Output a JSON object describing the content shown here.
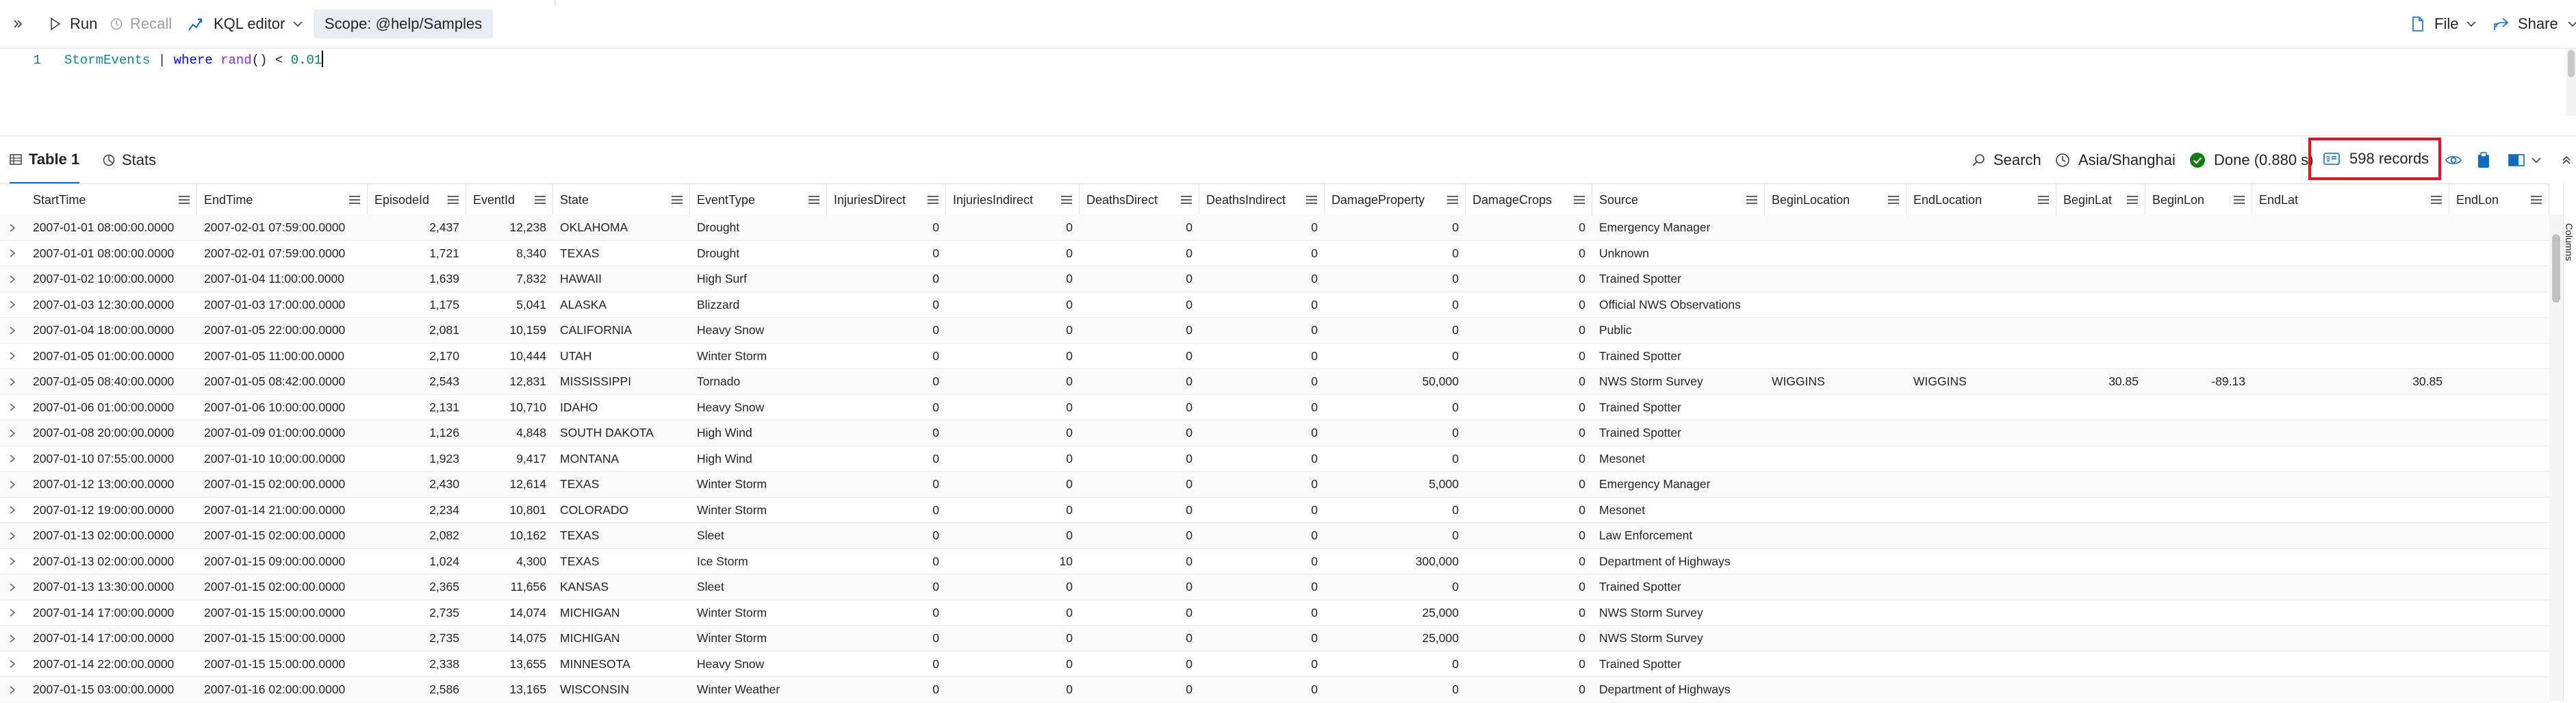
{
  "toolbar": {
    "run_label": "Run",
    "recall_label": "Recall",
    "kql_editor_label": "KQL editor",
    "scope_label": "Scope: @help/Samples",
    "file_label": "File",
    "share_label": "Share"
  },
  "editor": {
    "line_number": "1",
    "tokens": {
      "table": "StormEvents",
      "pipe": " | ",
      "keyword": "where",
      "space": " ",
      "function": "rand",
      "rest": "() < ",
      "number": "0.01"
    }
  },
  "results": {
    "tab_table": "Table 1",
    "tab_stats": "Stats",
    "search_label": "Search",
    "timezone": "Asia/Shanghai",
    "status": "Done (0.880 s)",
    "records": "598 records",
    "columns_panel": "Columns"
  },
  "columns": [
    "StartTime",
    "EndTime",
    "EpisodeId",
    "EventId",
    "State",
    "EventType",
    "InjuriesDirect",
    "InjuriesIndirect",
    "DeathsDirect",
    "DeathsIndirect",
    "DamageProperty",
    "DamageCrops",
    "Source",
    "BeginLocation",
    "EndLocation",
    "BeginLat",
    "BeginLon",
    "EndLat",
    "EndLon"
  ],
  "rows": [
    [
      "2007-01-01 08:00:00.0000",
      "2007-02-01 07:59:00.0000",
      "2,437",
      "12,238",
      "OKLAHOMA",
      "Drought",
      "0",
      "0",
      "0",
      "0",
      "0",
      "0",
      "Emergency Manager",
      "",
      "",
      "",
      "",
      "",
      ""
    ],
    [
      "2007-01-01 08:00:00.0000",
      "2007-02-01 07:59:00.0000",
      "1,721",
      "8,340",
      "TEXAS",
      "Drought",
      "0",
      "0",
      "0",
      "0",
      "0",
      "0",
      "Unknown",
      "",
      "",
      "",
      "",
      "",
      ""
    ],
    [
      "2007-01-02 10:00:00.0000",
      "2007-01-04 11:00:00.0000",
      "1,639",
      "7,832",
      "HAWAII",
      "High Surf",
      "0",
      "0",
      "0",
      "0",
      "0",
      "0",
      "Trained Spotter",
      "",
      "",
      "",
      "",
      "",
      ""
    ],
    [
      "2007-01-03 12:30:00.0000",
      "2007-01-03 17:00:00.0000",
      "1,175",
      "5,041",
      "ALASKA",
      "Blizzard",
      "0",
      "0",
      "0",
      "0",
      "0",
      "0",
      "Official NWS Observations",
      "",
      "",
      "",
      "",
      "",
      ""
    ],
    [
      "2007-01-04 18:00:00.0000",
      "2007-01-05 22:00:00.0000",
      "2,081",
      "10,159",
      "CALIFORNIA",
      "Heavy Snow",
      "0",
      "0",
      "0",
      "0",
      "0",
      "0",
      "Public",
      "",
      "",
      "",
      "",
      "",
      ""
    ],
    [
      "2007-01-05 01:00:00.0000",
      "2007-01-05 11:00:00.0000",
      "2,170",
      "10,444",
      "UTAH",
      "Winter Storm",
      "0",
      "0",
      "0",
      "0",
      "0",
      "0",
      "Trained Spotter",
      "",
      "",
      "",
      "",
      "",
      ""
    ],
    [
      "2007-01-05 08:40:00.0000",
      "2007-01-05 08:42:00.0000",
      "2,543",
      "12,831",
      "MISSISSIPPI",
      "Tornado",
      "0",
      "0",
      "0",
      "0",
      "50,000",
      "0",
      "NWS Storm Survey",
      "WIGGINS",
      "WIGGINS",
      "30.85",
      "-89.13",
      "30.85",
      ""
    ],
    [
      "2007-01-06 01:00:00.0000",
      "2007-01-06 10:00:00.0000",
      "2,131",
      "10,710",
      "IDAHO",
      "Heavy Snow",
      "0",
      "0",
      "0",
      "0",
      "0",
      "0",
      "Trained Spotter",
      "",
      "",
      "",
      "",
      "",
      ""
    ],
    [
      "2007-01-08 20:00:00.0000",
      "2007-01-09 01:00:00.0000",
      "1,126",
      "4,848",
      "SOUTH DAKOTA",
      "High Wind",
      "0",
      "0",
      "0",
      "0",
      "0",
      "0",
      "Trained Spotter",
      "",
      "",
      "",
      "",
      "",
      ""
    ],
    [
      "2007-01-10 07:55:00.0000",
      "2007-01-10 10:00:00.0000",
      "1,923",
      "9,417",
      "MONTANA",
      "High Wind",
      "0",
      "0",
      "0",
      "0",
      "0",
      "0",
      "Mesonet",
      "",
      "",
      "",
      "",
      "",
      ""
    ],
    [
      "2007-01-12 13:00:00.0000",
      "2007-01-15 02:00:00.0000",
      "2,430",
      "12,614",
      "TEXAS",
      "Winter Storm",
      "0",
      "0",
      "0",
      "0",
      "5,000",
      "0",
      "Emergency Manager",
      "",
      "",
      "",
      "",
      "",
      ""
    ],
    [
      "2007-01-12 19:00:00.0000",
      "2007-01-14 21:00:00.0000",
      "2,234",
      "10,801",
      "COLORADO",
      "Winter Storm",
      "0",
      "0",
      "0",
      "0",
      "0",
      "0",
      "Mesonet",
      "",
      "",
      "",
      "",
      "",
      ""
    ],
    [
      "2007-01-13 02:00:00.0000",
      "2007-01-15 02:00:00.0000",
      "2,082",
      "10,162",
      "TEXAS",
      "Sleet",
      "0",
      "0",
      "0",
      "0",
      "0",
      "0",
      "Law Enforcement",
      "",
      "",
      "",
      "",
      "",
      ""
    ],
    [
      "2007-01-13 02:00:00.0000",
      "2007-01-15 09:00:00.0000",
      "1,024",
      "4,300",
      "TEXAS",
      "Ice Storm",
      "0",
      "10",
      "0",
      "0",
      "300,000",
      "0",
      "Department of Highways",
      "",
      "",
      "",
      "",
      "",
      ""
    ],
    [
      "2007-01-13 13:30:00.0000",
      "2007-01-15 02:00:00.0000",
      "2,365",
      "11,656",
      "KANSAS",
      "Sleet",
      "0",
      "0",
      "0",
      "0",
      "0",
      "0",
      "Trained Spotter",
      "",
      "",
      "",
      "",
      "",
      ""
    ],
    [
      "2007-01-14 17:00:00.0000",
      "2007-01-15 15:00:00.0000",
      "2,735",
      "14,074",
      "MICHIGAN",
      "Winter Storm",
      "0",
      "0",
      "0",
      "0",
      "25,000",
      "0",
      "NWS Storm Survey",
      "",
      "",
      "",
      "",
      "",
      ""
    ],
    [
      "2007-01-14 17:00:00.0000",
      "2007-01-15 15:00:00.0000",
      "2,735",
      "14,075",
      "MICHIGAN",
      "Winter Storm",
      "0",
      "0",
      "0",
      "0",
      "25,000",
      "0",
      "NWS Storm Survey",
      "",
      "",
      "",
      "",
      "",
      ""
    ],
    [
      "2007-01-14 22:00:00.0000",
      "2007-01-15 15:00:00.0000",
      "2,338",
      "13,655",
      "MINNESOTA",
      "Heavy Snow",
      "0",
      "0",
      "0",
      "0",
      "0",
      "0",
      "Trained Spotter",
      "",
      "",
      "",
      "",
      "",
      ""
    ],
    [
      "2007-01-15 03:00:00.0000",
      "2007-01-16 02:00:00.0000",
      "2,586",
      "13,165",
      "WISCONSIN",
      "Winter Weather",
      "0",
      "0",
      "0",
      "0",
      "0",
      "0",
      "Department of Highways",
      "",
      "",
      "",
      "",
      "",
      ""
    ]
  ],
  "colors": {
    "accent": "#0f6cbd",
    "highlight_border": "#e81123",
    "done_green": "#107c10"
  }
}
